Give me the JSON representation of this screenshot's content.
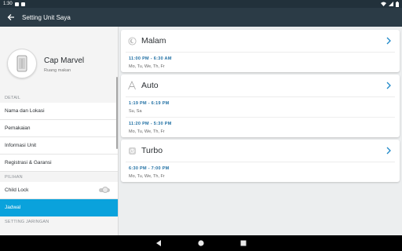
{
  "status_bar": {
    "time": "1:30"
  },
  "app_bar": {
    "title": "Setting Unit Saya"
  },
  "device": {
    "name": "Cap Marvel",
    "room": "Ruang makan"
  },
  "sidebar": {
    "detail_label": "DETAIL",
    "detail_items": [
      "Nama dan Lokasi",
      "Pemakaian",
      "Informasi Unit",
      "Registrasi & Garansi"
    ],
    "options_label": "PILIHAN",
    "child_lock_label": "Child Lock",
    "schedule_label": "Jadwal",
    "network_label": "SETTING JARINGAN"
  },
  "cards": [
    {
      "title": "Malam",
      "icon": "moon-icon",
      "schedules": [
        {
          "time": "11:00 PM  -  6:30 AM",
          "days": "Mo, Tu, We, Th, Fr"
        }
      ]
    },
    {
      "title": "Auto",
      "icon": "auto-icon",
      "schedules": [
        {
          "time": "1:19 PM  -  6:19 PM",
          "days": "Su, Sa"
        },
        {
          "time": "11:20 PM  -  5:30 PM",
          "days": "Mo, Tu, We, Th, Fr"
        }
      ]
    },
    {
      "title": "Turbo",
      "icon": "turbo-icon",
      "schedules": [
        {
          "time": "6:30 PM  -  7:00 PM",
          "days": "Mo, Tu, We, Th, Fr"
        }
      ]
    }
  ],
  "colors": {
    "accent": "#0aa2dc",
    "app_bar": "#2b3b46",
    "chevron": "#1e88c8"
  }
}
